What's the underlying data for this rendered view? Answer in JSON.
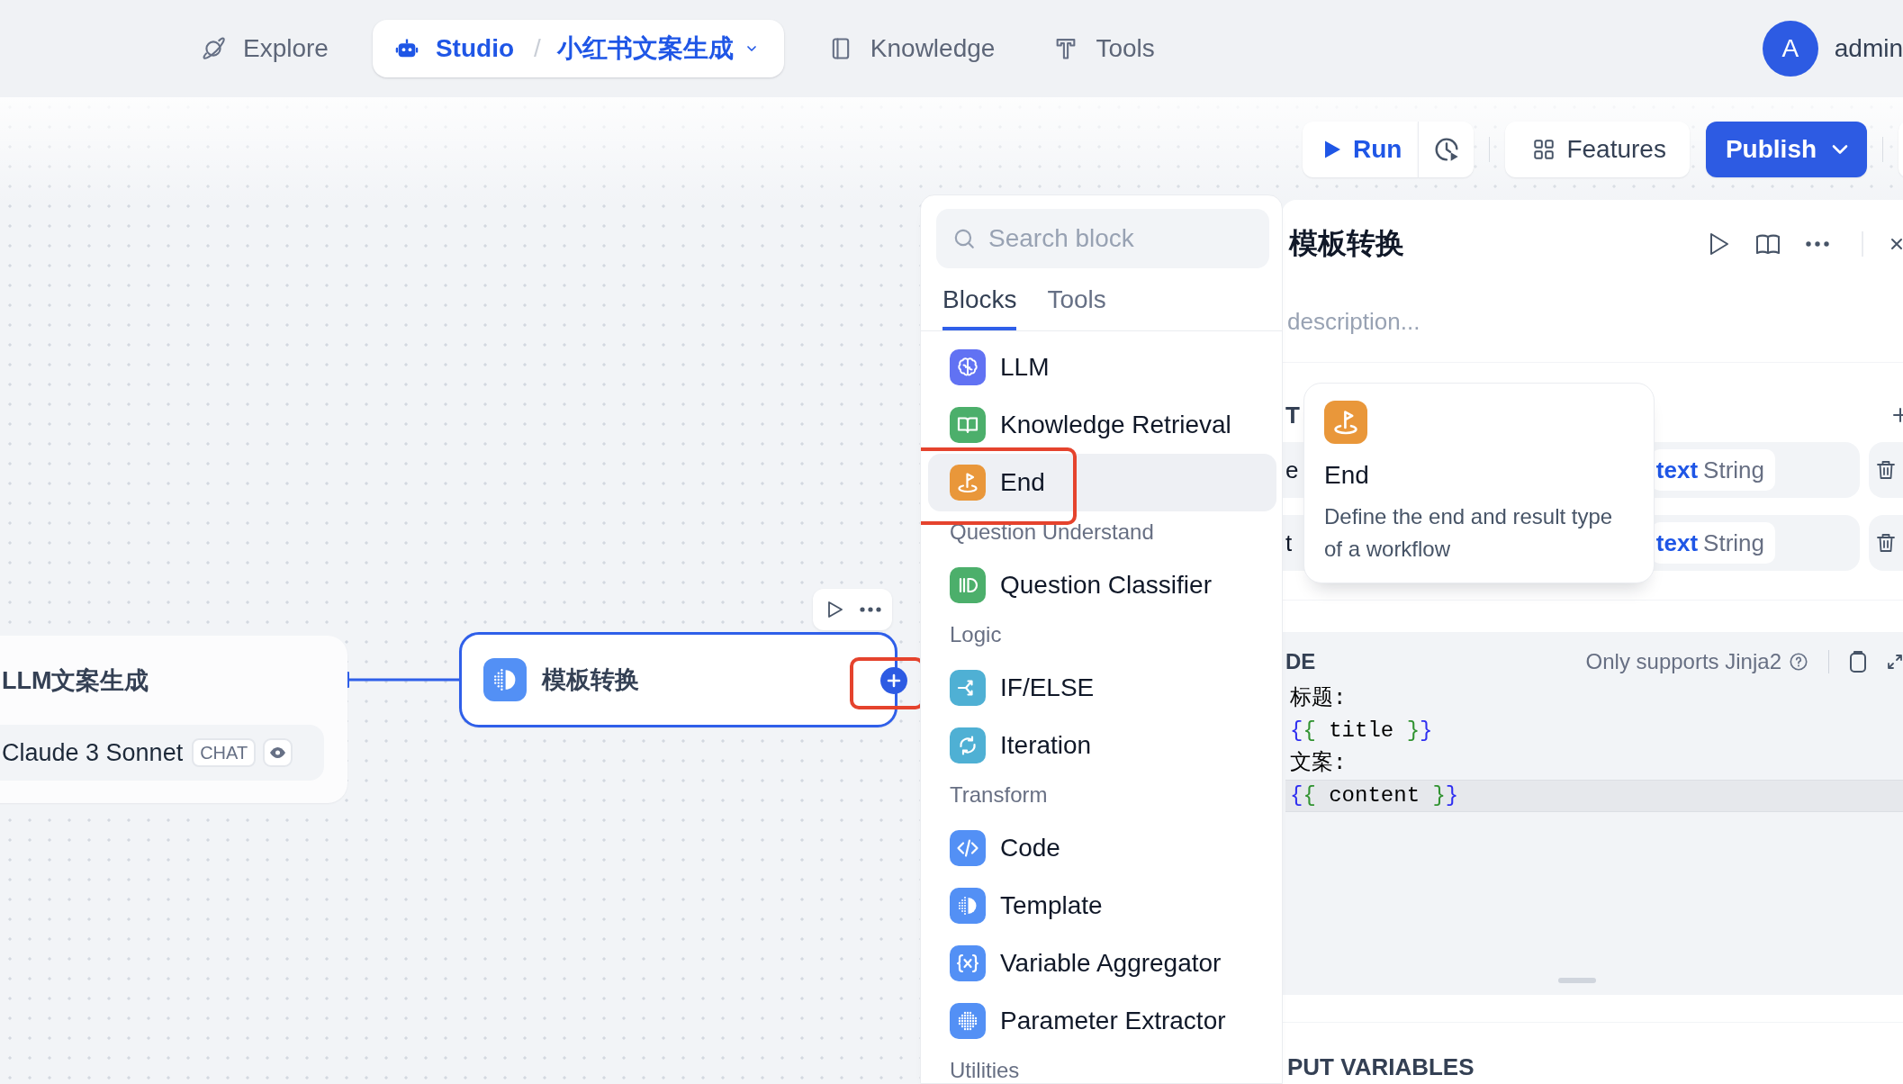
{
  "nav": {
    "items": [
      {
        "label": "Explore",
        "selected": false
      },
      {
        "label": "Studio",
        "separator": "/",
        "app": "小红书文案生成",
        "selected": true
      },
      {
        "label": "Knowledge",
        "selected": false
      },
      {
        "label": "Tools",
        "selected": false
      }
    ]
  },
  "user": {
    "initial": "A",
    "name": "admin"
  },
  "toolbar": {
    "run": "Run",
    "features": "Features",
    "publish": "Publish"
  },
  "canvas": {
    "nodes": [
      {
        "kind": "llm",
        "title": "LLM文案生成",
        "model": "Claude 3 Sonnet",
        "mode": "CHAT",
        "selected": false
      },
      {
        "kind": "template",
        "title": "模板转换",
        "selected": true,
        "annotated": true
      }
    ]
  },
  "block_menu": {
    "search": {
      "placeholder": "Search block"
    },
    "tabs": [
      {
        "label": "Blocks",
        "selected": true
      },
      {
        "label": "Tools",
        "selected": false
      }
    ],
    "entries": [
      {
        "kind": "block",
        "label": "LLM",
        "color": "#6172f3",
        "hovered": false,
        "annotated": false
      },
      {
        "kind": "block",
        "label": "Knowledge Retrieval",
        "color": "#4caf6b",
        "hovered": false,
        "annotated": false
      },
      {
        "kind": "block",
        "label": "End",
        "color": "#e9973a",
        "hovered": true,
        "annotated": true
      },
      {
        "kind": "section",
        "label": "Question Understand"
      },
      {
        "kind": "block",
        "label": "Question Classifier",
        "color": "#4caf6b",
        "hovered": false,
        "annotated": false
      },
      {
        "kind": "section",
        "label": "Logic"
      },
      {
        "kind": "block",
        "label": "IF/ELSE",
        "color": "#4fb0d4",
        "hovered": false,
        "annotated": false
      },
      {
        "kind": "block",
        "label": "Iteration",
        "color": "#4fb0d4",
        "hovered": false,
        "annotated": false
      },
      {
        "kind": "section",
        "label": "Transform"
      },
      {
        "kind": "block",
        "label": "Code",
        "color": "#5390f5",
        "hovered": false,
        "annotated": false
      },
      {
        "kind": "block",
        "label": "Template",
        "color": "#5390f5",
        "hovered": false,
        "annotated": false
      },
      {
        "kind": "block",
        "label": "Variable Aggregator",
        "color": "#5390f5",
        "hovered": false,
        "annotated": false
      },
      {
        "kind": "block",
        "label": "Parameter Extractor",
        "color": "#5390f5",
        "hovered": false,
        "annotated": false
      },
      {
        "kind": "section",
        "label": "Utilities"
      }
    ]
  },
  "tooltip": {
    "title": "End",
    "description": "Define the end and result type of a workflow"
  },
  "panel": {
    "title": "模板转换",
    "description": {
      "placeholder": "description..."
    },
    "input_heading": "T",
    "variables": [
      {
        "name": "e",
        "ref": "text",
        "type": "String"
      },
      {
        "name": "t",
        "ref": "text",
        "type": "String"
      }
    ],
    "code": {
      "heading": "DE",
      "hint": "Only supports Jinja2",
      "lines": [
        {
          "active": false,
          "tokens": [
            {
              "kind": "text",
              "text": "标题:"
            }
          ]
        },
        {
          "active": false,
          "tokens": [
            {
              "kind": "brace-outer",
              "text": "{"
            },
            {
              "kind": "brace-inner",
              "text": "{"
            },
            {
              "kind": "text",
              "text": " title "
            },
            {
              "kind": "brace-inner",
              "text": "}"
            },
            {
              "kind": "brace-outer",
              "text": "}"
            }
          ]
        },
        {
          "active": false,
          "tokens": [
            {
              "kind": "text",
              "text": "文案:"
            }
          ]
        },
        {
          "active": true,
          "tokens": [
            {
              "kind": "brace-outer",
              "text": "{"
            },
            {
              "kind": "brace-inner",
              "text": "{"
            },
            {
              "kind": "text",
              "text": " content "
            },
            {
              "kind": "brace-inner",
              "text": "}"
            },
            {
              "kind": "brace-outer",
              "text": "}"
            }
          ]
        }
      ]
    },
    "output_heading": "PUT VARIABLES"
  }
}
